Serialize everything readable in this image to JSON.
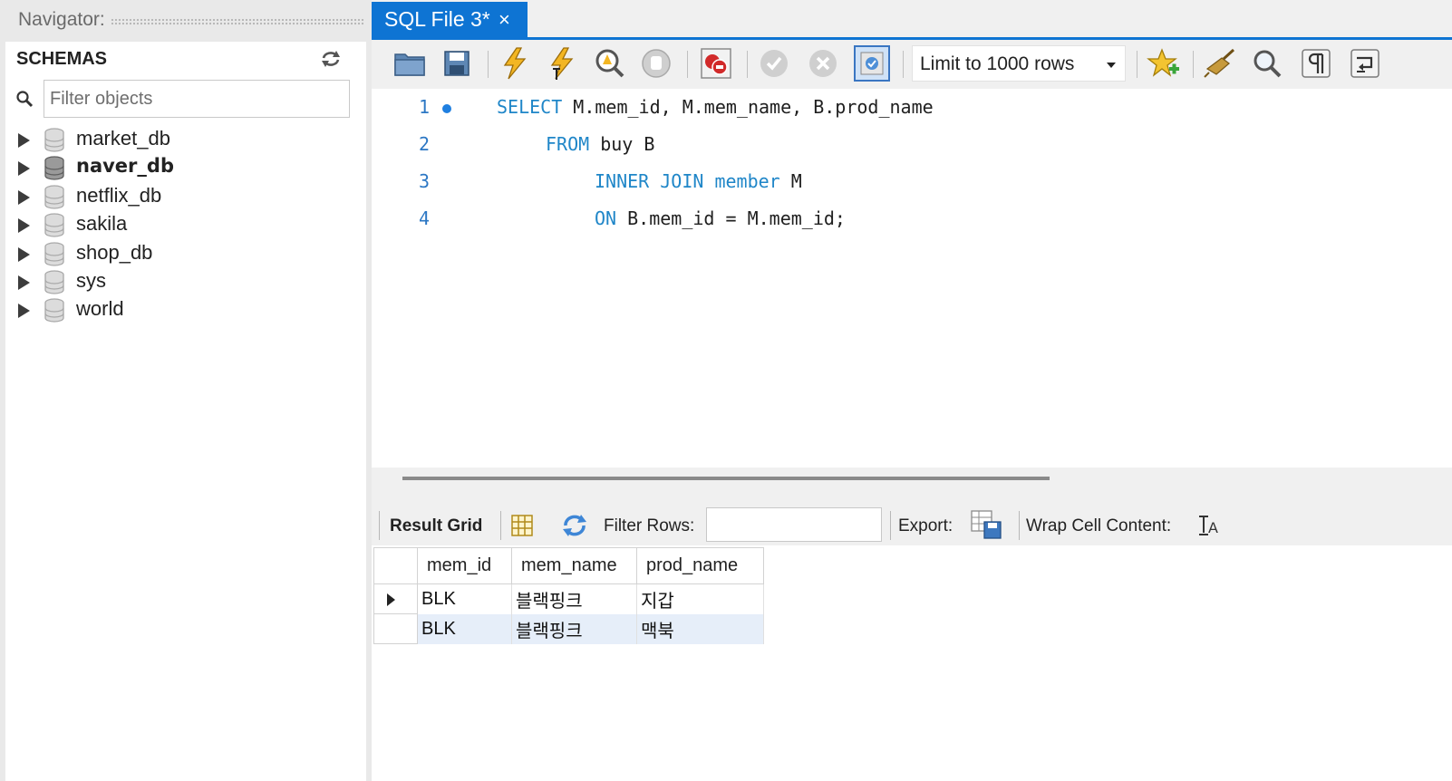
{
  "navigator": {
    "title": "Navigator:",
    "schemas_label": "SCHEMAS",
    "filter_placeholder": "Filter objects",
    "schemas": [
      {
        "name": "market_db",
        "active": false
      },
      {
        "name": "naver_db",
        "active": true
      },
      {
        "name": "netflix_db",
        "active": false
      },
      {
        "name": "sakila",
        "active": false
      },
      {
        "name": "shop_db",
        "active": false
      },
      {
        "name": "sys",
        "active": false
      },
      {
        "name": "world",
        "active": false
      }
    ],
    "icons": {
      "refresh": "refresh-icon",
      "search": "search-icon",
      "database": "database-icon"
    }
  },
  "tab": {
    "label": "SQL File 3*",
    "close": "×"
  },
  "toolbar": {
    "limit_label": "Limit to 1000 rows",
    "icons": [
      "open-folder-icon",
      "save-icon",
      "execute-icon",
      "execute-current-icon",
      "explain-icon",
      "stop-icon",
      "toggle-error-stop-icon",
      "commit-icon",
      "rollback-icon",
      "autocommit-icon",
      "bookmark-icon",
      "beautify-icon",
      "find-icon",
      "invisible-chars-icon",
      "wrap-lines-icon"
    ]
  },
  "editor": {
    "lines": [
      {
        "num": "1",
        "dot": true,
        "kw": "SELECT",
        "rest": " M.mem_id, M.mem_name, B.prod_name"
      },
      {
        "num": "2",
        "dot": false,
        "kw": "FROM",
        "rest": " buy B"
      },
      {
        "num": "3",
        "dot": false,
        "kw": "INNER JOIN member",
        "rest": " M"
      },
      {
        "num": "4",
        "dot": false,
        "kw": "ON",
        "rest": " B.mem_id = M.mem_id;"
      }
    ]
  },
  "result": {
    "grid_label": "Result Grid",
    "filter_rows_label": "Filter Rows:",
    "export_label": "Export:",
    "wrap_label": "Wrap Cell Content:",
    "columns": [
      "mem_id",
      "mem_name",
      "prod_name"
    ],
    "rows": [
      [
        "BLK",
        "블랙핑크",
        "지갑"
      ],
      [
        "BLK",
        "블랙핑크",
        "맥북"
      ]
    ]
  },
  "colors": {
    "accent": "#0e74d3",
    "keyword": "#1f86c8",
    "selected_row": "#e6eef9"
  }
}
